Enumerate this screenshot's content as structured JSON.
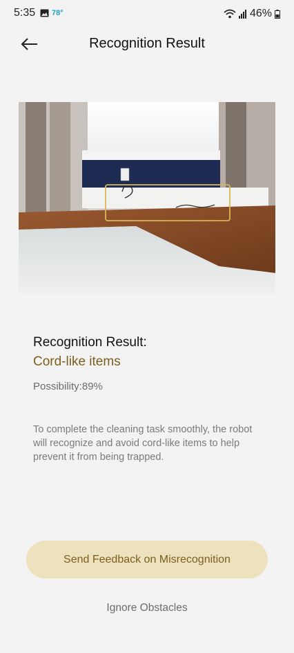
{
  "status_bar": {
    "time": "5:35",
    "temperature": "78°",
    "battery": "46%"
  },
  "header": {
    "title": "Recognition Result"
  },
  "result": {
    "heading": "Recognition Result:",
    "value": "Cord-like items",
    "possibility": "Possibility:89%",
    "description": "To complete the cleaning task smoothly, the robot will recognize and avoid cord-like items to help prevent it from being trapped."
  },
  "actions": {
    "feedback_label": "Send Feedback on Misrecognition",
    "ignore_label": "Ignore Obstacles"
  },
  "colors": {
    "accent": "#7a5e1d",
    "button_bg": "#ede2bd",
    "background": "#f3f3f3"
  }
}
